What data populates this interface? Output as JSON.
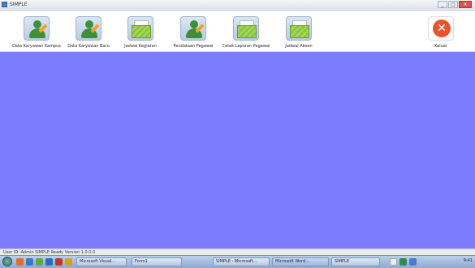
{
  "window": {
    "title": "SIMPLE"
  },
  "toolbar": {
    "buttons": [
      {
        "label": "Data Karyawan Kampus",
        "icon": "person-edit-icon"
      },
      {
        "label": "Data Karyawan Baru",
        "icon": "person-edit-icon"
      },
      {
        "label": "Jadwal Kegiatan",
        "icon": "folder-icon"
      },
      {
        "label": "Pendataan Pegawai",
        "icon": "person-edit-icon"
      },
      {
        "label": "Cetak Laporan Pegawai",
        "icon": "folder-icon"
      },
      {
        "label": "Jadwal Absen",
        "icon": "folder-icon"
      },
      {
        "label": "Keluar",
        "icon": "exit-icon"
      }
    ]
  },
  "status": {
    "text": "User ID: Admin SIMPLE   Ready   Version 1.0.0.0"
  },
  "taskbar": {
    "tasks": [
      {
        "label": "Microsoft Visual..."
      },
      {
        "label": "Form1"
      },
      {
        "label": "SIMPLE - Microsoft..."
      },
      {
        "label": "Microsoft Word..."
      },
      {
        "label": "SIMPLE"
      }
    ],
    "clock": "9:41"
  }
}
